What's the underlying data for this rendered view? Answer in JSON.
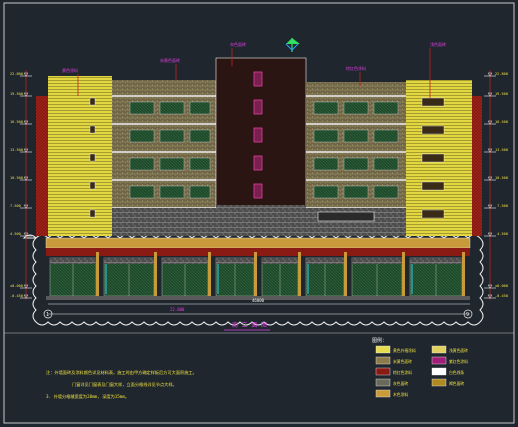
{
  "drawing": {
    "background": "#1f262e",
    "frame_color": "#c8c8c8",
    "title": "南 立 面 图",
    "callouts": [
      "黄色涂料",
      "米黄色面砖",
      "灰色面砖",
      "棕红色涂料",
      "浅色面砖"
    ],
    "overall_width": "46000",
    "axis_start": "1",
    "axis_end": "9",
    "dimension_left": "22.800",
    "dimension_right": "22.800",
    "level_values": [
      "22.800",
      "19.500",
      "16.500",
      "13.500",
      "10.500",
      "7.500",
      "4.500",
      "±0.000",
      "-0.450"
    ],
    "notes": [
      "注：外墙面砖及涂料颜色详见材料表，施工时由甲方确定样板后方可大面积施工。",
      "门窗详见门窗表及门窗大样，立面分格线详见节点大样。",
      "3. 外墙分格缝宽度为20mm, 深度为15mm。"
    ]
  },
  "legend": {
    "title": "图例：",
    "items": [
      {
        "swatch": "#e6dc50",
        "label": "黄色外墙涂料"
      },
      {
        "swatch": "#8c7a4a",
        "label": "米黄色面砖"
      },
      {
        "swatch": "#8a1a14",
        "label": "棕红色涂料"
      },
      {
        "swatch": "#6a6a5a",
        "label": "灰色面砖"
      },
      {
        "swatch": "#c89a3a",
        "label": "木色涂料"
      },
      {
        "swatch": "#e0d060",
        "label": "浅黄色面砖"
      },
      {
        "swatch": "#a01e7a",
        "label": "紫红色涂料"
      },
      {
        "swatch": "#ffffff",
        "label": "白色线条"
      },
      {
        "swatch": "#b08a20",
        "label": "褐色面砖"
      }
    ]
  },
  "colors": {
    "yellow_facade": "#e2d642",
    "brick": "#7d7350",
    "dark_tower": "#2b1512",
    "red": "#c2221c",
    "magenta": "#c0207a",
    "green_glass": "#245a34",
    "grey_stone": "#5a5a5a",
    "white": "#f0f0f0",
    "cyan": "#30d0e8"
  }
}
